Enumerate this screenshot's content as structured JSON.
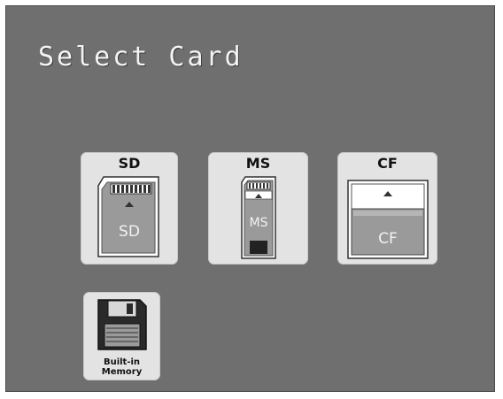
{
  "screen": {
    "title": "Select Card"
  },
  "cards": [
    {
      "id": "sd",
      "label": "SD",
      "card_text": "SD",
      "icon": "sd-card-icon"
    },
    {
      "id": "ms",
      "label": "MS",
      "card_text": "MS",
      "icon": "memory-stick-icon"
    },
    {
      "id": "cf",
      "label": "CF",
      "card_text": "CF",
      "icon": "compactflash-card-icon"
    }
  ],
  "builtin_memory": {
    "label_line1": "Built-in",
    "label_line2": "Memory",
    "icon": "floppy-disk-icon"
  },
  "colors": {
    "screen_bg": "#6f6f6f",
    "tile_bg": "#e3e3e3",
    "card_gray": "#9a9a9a",
    "title_text": "#f4f4f4"
  }
}
